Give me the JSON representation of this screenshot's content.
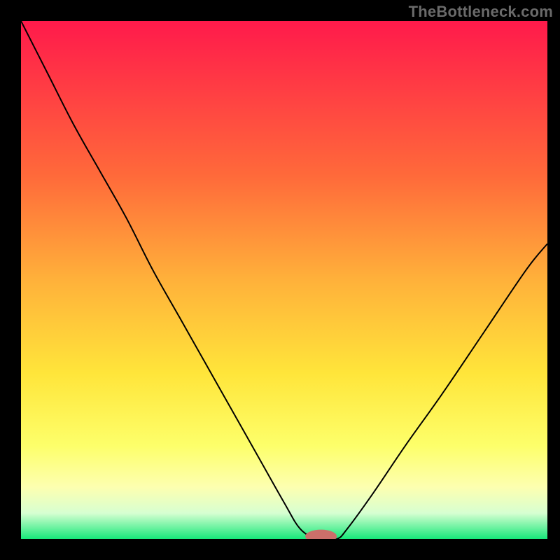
{
  "watermark": "TheBottleneck.com",
  "chart_data": {
    "type": "line",
    "title": "",
    "xlabel": "",
    "ylabel": "",
    "xlim": [
      0,
      100
    ],
    "ylim": [
      0,
      100
    ],
    "grid": false,
    "legend": false,
    "background_gradient": {
      "stops": [
        {
          "y": 0,
          "color": "#ff1a4b"
        },
        {
          "y": 30,
          "color": "#ff6a3a"
        },
        {
          "y": 50,
          "color": "#ffb13a"
        },
        {
          "y": 68,
          "color": "#ffe53a"
        },
        {
          "y": 82,
          "color": "#fdff6a"
        },
        {
          "y": 90,
          "color": "#fdffb0"
        },
        {
          "y": 95,
          "color": "#d7ffd1"
        },
        {
          "y": 100,
          "color": "#17e87a"
        }
      ]
    },
    "series": [
      {
        "name": "bottleneck-curve",
        "x": [
          0,
          5,
          10,
          15,
          20,
          25,
          30,
          35,
          40,
          45,
          50,
          53,
          56,
          57,
          60,
          62,
          67,
          73,
          80,
          88,
          96,
          100
        ],
        "y": [
          100,
          90,
          80,
          71,
          62,
          52,
          43,
          34,
          25,
          16,
          7,
          2,
          0,
          0,
          0,
          2,
          9,
          18,
          28,
          40,
          52,
          57
        ]
      }
    ],
    "marker": {
      "x": 57,
      "y": 0.5,
      "color": "#cc6f6a",
      "rx": 3,
      "ry": 1.3
    }
  }
}
